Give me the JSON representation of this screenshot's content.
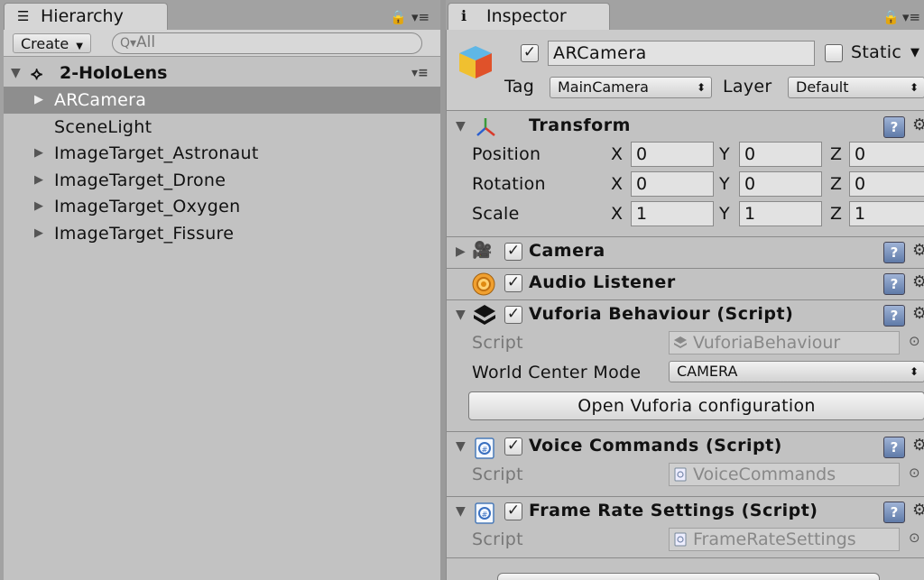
{
  "hierarchy": {
    "tab_label": "Hierarchy",
    "create_label": "Create",
    "search_placeholder": "All",
    "scene_name": "2-HoloLens",
    "items": [
      {
        "label": "ARCamera",
        "expandable": true,
        "selected": true
      },
      {
        "label": "SceneLight",
        "expandable": false,
        "selected": false
      },
      {
        "label": "ImageTarget_Astronaut",
        "expandable": true,
        "selected": false
      },
      {
        "label": "ImageTarget_Drone",
        "expandable": true,
        "selected": false
      },
      {
        "label": "ImageTarget_Oxygen",
        "expandable": true,
        "selected": false
      },
      {
        "label": "ImageTarget_Fissure",
        "expandable": true,
        "selected": false
      }
    ]
  },
  "inspector": {
    "tab_label": "Inspector",
    "object_name": "ARCamera",
    "active_checked": true,
    "static_label": "Static",
    "static_checked": false,
    "tag_label": "Tag",
    "tag_value": "MainCamera",
    "layer_label": "Layer",
    "layer_value": "Default",
    "transform": {
      "title": "Transform",
      "position_label": "Position",
      "rotation_label": "Rotation",
      "scale_label": "Scale",
      "axis_x": "X",
      "axis_y": "Y",
      "axis_z": "Z",
      "position": {
        "x": "0",
        "y": "0",
        "z": "0"
      },
      "rotation": {
        "x": "0",
        "y": "0",
        "z": "0"
      },
      "scale": {
        "x": "1",
        "y": "1",
        "z": "1"
      }
    },
    "camera": {
      "title": "Camera",
      "enabled": true
    },
    "audio_listener": {
      "title": "Audio Listener",
      "enabled": true
    },
    "vuforia": {
      "title": "Vuforia Behaviour (Script)",
      "script_label": "Script",
      "script_value": "VuforiaBehaviour",
      "world_center_label": "World Center Mode",
      "world_center_value": "CAMERA",
      "open_config_label": "Open Vuforia configuration"
    },
    "voice_commands": {
      "title": "Voice Commands (Script)",
      "script_label": "Script",
      "script_value": "VoiceCommands"
    },
    "frame_rate": {
      "title": "Frame Rate Settings (Script)",
      "script_label": "Script",
      "script_value": "FrameRateSettings"
    }
  },
  "colors": {
    "panel_bg": "#c2c2c2",
    "selection": "#8e8e8e",
    "help_blue": "#5f7aa8"
  }
}
